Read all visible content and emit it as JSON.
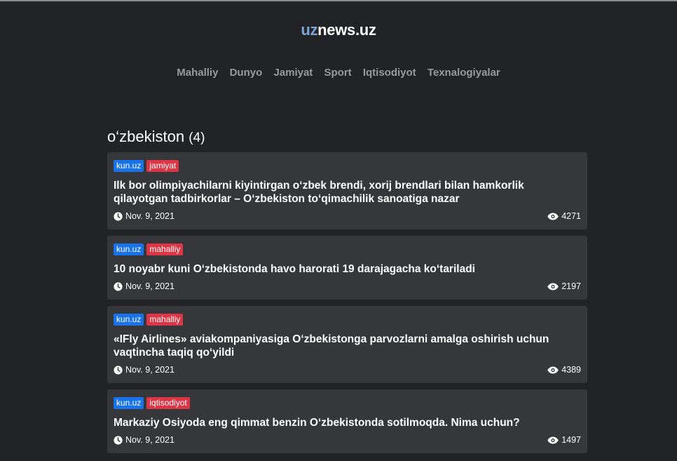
{
  "logo": {
    "prefix": "uz",
    "rest": "news.uz"
  },
  "nav": [
    "Mahalliy",
    "Dunyo",
    "Jamiyat",
    "Sport",
    "Iqtisodiyot",
    "Texnalogiyalar"
  ],
  "heading": {
    "tag": "o‘zbekiston",
    "count": "(4)"
  },
  "articles": [
    {
      "source": "kun.uz",
      "category": "jamiyat",
      "title": "Ilk bor olimpiyachilarni kiyintirgan o‘zbek brendi, xorij brendlari bilan hamkorlik qilayotgan tadbirkorlar – O‘zbekiston to‘qimachilik sanoatiga nazar",
      "date": "Nov. 9, 2021",
      "views": "4271"
    },
    {
      "source": "kun.uz",
      "category": "mahalliy",
      "title": "10 noyabr kuni O‘zbekistonda havo harorati 19 darajagacha ko‘tariladi",
      "date": "Nov. 9, 2021",
      "views": "2197"
    },
    {
      "source": "kun.uz",
      "category": "mahalliy",
      "title": "«IFly Airlines» aviakompaniyasiga O‘zbekistonga parvozlarni amalga oshirish uchun vaqtincha taqiq qo‘yildi",
      "date": "Nov. 9, 2021",
      "views": "4389"
    },
    {
      "source": "kun.uz",
      "category": "iqtisodiyot",
      "title": "Markaziy Osiyoda eng qimmat benzin O‘zbekistonda sotilmoqda. Nima uchun?",
      "date": "Nov. 9, 2021",
      "views": "1497"
    }
  ],
  "icons": {
    "date": "clock-icon",
    "views": "eye-icon"
  }
}
